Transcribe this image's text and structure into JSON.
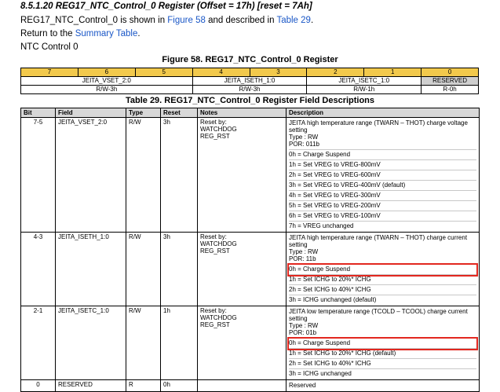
{
  "header": {
    "section": "8.5.1.20   REG17_NTC_Control_0 Register (Offset = 17h) [reset = 7Ah]",
    "line2_pre": "REG17_NTC_Control_0 is shown in ",
    "line2_fig_link": "Figure 58",
    "line2_mid": " and described in ",
    "line2_tab_link": "Table 29",
    "line2_post": ".",
    "line3_pre": "Return to the ",
    "line3_link": "Summary Table",
    "line3_post": ".",
    "line4": "NTC Control 0"
  },
  "figure": {
    "title": "Figure 58.  REG17_NTC_Control_0 Register",
    "bits": [
      "7",
      "6",
      "5",
      "4",
      "3",
      "2",
      "1",
      "0"
    ],
    "fields": [
      "JEITA_VSET_2:0",
      "JEITA_ISETH_1:0",
      "JEITA_ISETC_1:0",
      "RESERVED"
    ],
    "access": [
      "R/W-3h",
      "R/W-3h",
      "R/W-1h",
      "R-0h"
    ]
  },
  "table": {
    "title": "Table 29. REG17_NTC_Control_0 Register Field Descriptions",
    "headers": [
      "Bit",
      "Field",
      "Type",
      "Reset",
      "Notes",
      "Description"
    ],
    "rows": [
      {
        "bit": "7-5",
        "field": "JEITA_VSET_2:0",
        "type": "R/W",
        "reset": "3h",
        "notes": [
          "Reset by:",
          "WATCHDOG",
          "REG_RST"
        ],
        "desc": [
          "JEITA high temperature range (TWARN – THOT) charge voltage setting\nType : RW\nPOR: 011b",
          "0h = Charge Suspend",
          "1h = Set VREG to VREG-800mV",
          "2h = Set VREG to VREG-600mV",
          "3h = Set VREG to VREG-400mV (default)",
          "4h = Set VREG to VREG-300mV",
          "5h = Set VREG to VREG-200mV",
          "6h = Set VREG to VREG-100mV",
          "7h = VREG unchanged"
        ]
      },
      {
        "bit": "4-3",
        "field": "JEITA_ISETH_1:0",
        "type": "R/W",
        "reset": "3h",
        "notes": [
          "Reset by:",
          "WATCHDOG",
          "REG_RST"
        ],
        "desc": [
          "JEITA high temperature range (TWARN – THOT) charge current setting\nType : RW\nPOR: 11b",
          "0h = Charge Suspend",
          "1h = Set ICHG to 20%* ICHG",
          "2h = Set ICHG to 40%* ICHG",
          "3h = ICHG unchanged (default)"
        ]
      },
      {
        "bit": "2-1",
        "field": "JEITA_ISETC_1:0",
        "type": "R/W",
        "reset": "1h",
        "notes": [
          "Reset by:",
          "WATCHDOG",
          "REG_RST"
        ],
        "desc": [
          "JEITA low temperature range (TCOLD – TCOOL) charge current setting\nType : RW\nPOR: 01b",
          "0h = Charge Suspend",
          "1h = Set ICHG to 20%* ICHG (default)",
          "2h = Set ICHG to 40%* ICHG",
          "3h = ICHG unchanged"
        ]
      },
      {
        "bit": "0",
        "field": "RESERVED",
        "type": "R",
        "reset": "0h",
        "notes": [],
        "desc": [
          "Reserved"
        ]
      }
    ]
  }
}
